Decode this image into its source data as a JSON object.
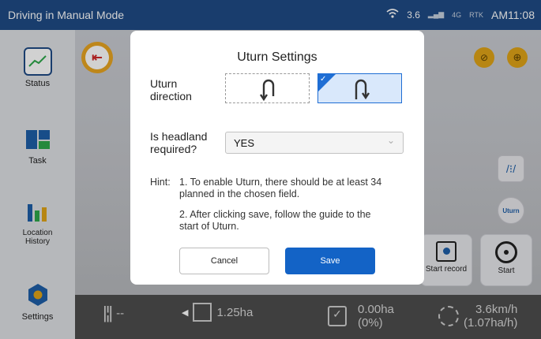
{
  "status_bar": {
    "mode": "Driving in Manual Mode",
    "network": "3.6",
    "signal_a": "4G",
    "signal_b": "RTK",
    "time": "AM11:08"
  },
  "sidebar": {
    "items": [
      {
        "label": "Status",
        "icon": "status-chart-icon"
      },
      {
        "label": "Task",
        "icon": "task-icon"
      },
      {
        "label": "Location History",
        "icon": "location-history-icon"
      },
      {
        "label": "Settings",
        "icon": "gear-icon"
      }
    ]
  },
  "bottom_bar": {
    "distance": "--",
    "width": "1.25ha",
    "area": "0.00ha",
    "area_percent": "(0%)",
    "speed": "3.6km/h",
    "rate": "(1.07ha/h)"
  },
  "controls": {
    "start_record": "Start record",
    "start": "Start",
    "uturn_badge": "Uturn"
  },
  "dialog": {
    "title": "Uturn Settings",
    "uturn_direction_label_1": "Uturn",
    "uturn_direction_label_2": "direction",
    "headland_label_1": "Is headland",
    "headland_label_2": "required?",
    "headland_value": "YES",
    "hint_prefix": "Hint:",
    "hint_1_line1": "1. To enable Uturn, there should be at least 34",
    "hint_1_line2": "planned in the chosen field.",
    "hint_2_line1": "2. After clicking save, follow the guide to the",
    "hint_2_line2": "start of Uturn.",
    "cancel": "Cancel",
    "save": "Save"
  },
  "colors": {
    "accent": "#1363c6",
    "status_bar": "#1f4b86",
    "selected_fill": "#d9e8fb"
  }
}
